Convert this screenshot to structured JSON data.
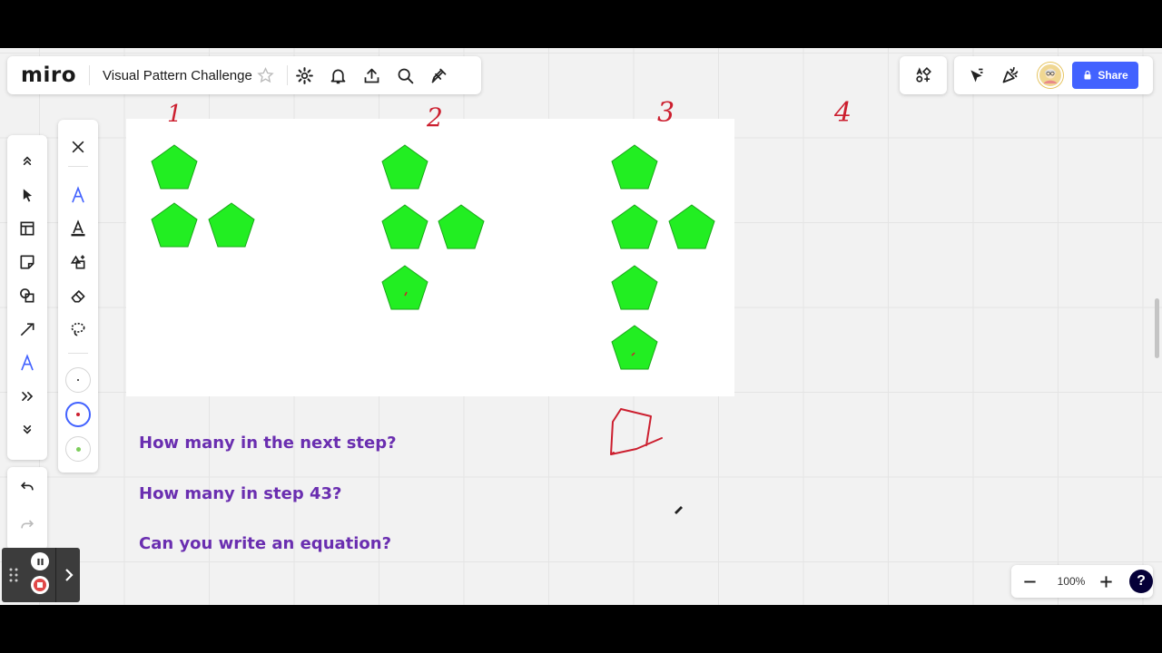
{
  "app": {
    "logo": "miro",
    "board_title": "Visual Pattern Challenge"
  },
  "topbar": {
    "icons": [
      "star-icon",
      "settings-icon",
      "bell-icon",
      "upload-icon",
      "search-icon",
      "plugin-icon"
    ]
  },
  "collab": {
    "share_label": "Share"
  },
  "board": {
    "step_labels": [
      "1",
      "2",
      "3",
      "4"
    ],
    "pentagon_color": "#22ee22",
    "questions": [
      "How many in the next step?",
      "How many in step 43?",
      "Can you write an equation?"
    ],
    "ink_color": "#cc1f2f"
  },
  "zoom": {
    "level": "100%",
    "help": "?"
  },
  "colors": {
    "accent": "#4262ff",
    "question_text": "#6a2eb0",
    "pentagon": "#22ee22"
  }
}
